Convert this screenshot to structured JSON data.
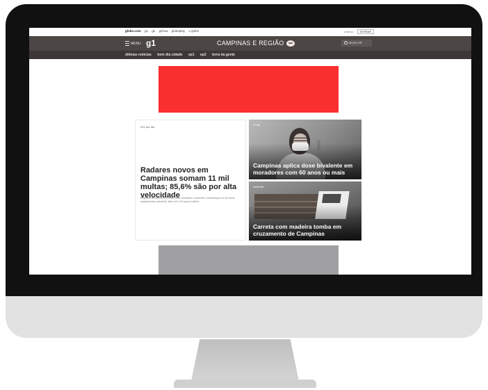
{
  "topbar": {
    "links": [
      "globo.com",
      "g1",
      "ge",
      "gshow",
      "globoplay",
      "o globo"
    ],
    "account_label": "criar sc.",
    "login_label": "ENTRAR"
  },
  "header": {
    "menu_label": "MENU",
    "logo": "g1",
    "region": "CAMPINAS E REGIÃO",
    "search_label": "BUSCAR"
  },
  "subnav": {
    "items": [
      "últimas notícias",
      "bom dia cidade",
      "ep1",
      "ep2",
      "terra da gente"
    ]
  },
  "main_story": {
    "time": "201 por dia",
    "title": "Radares novos em Campinas somam 11 mil multas; 85,6% são por alta velocidade",
    "summary": "Registros se referem a 43 dias, entre novembro e dezembro. Monitoração em 16 novos equipamentos operando, além dos 120 que já existem."
  },
  "side_stories": [
    {
      "tag": "1ª dia",
      "title": "Campinas aplica dose bivalente em moradores com 60 anos ou mais"
    },
    {
      "tag": "acidente",
      "title": "Carreta com madeira tomba em cruzamento de Campinas"
    }
  ],
  "colors": {
    "header_bg": "#4c4645",
    "subnav_bg": "#3d3837",
    "ad_top": "#fa2f2f",
    "ad_bottom": "#a0a0a3",
    "bezel": "#111111",
    "monitor_body": "#e2e2e2"
  }
}
